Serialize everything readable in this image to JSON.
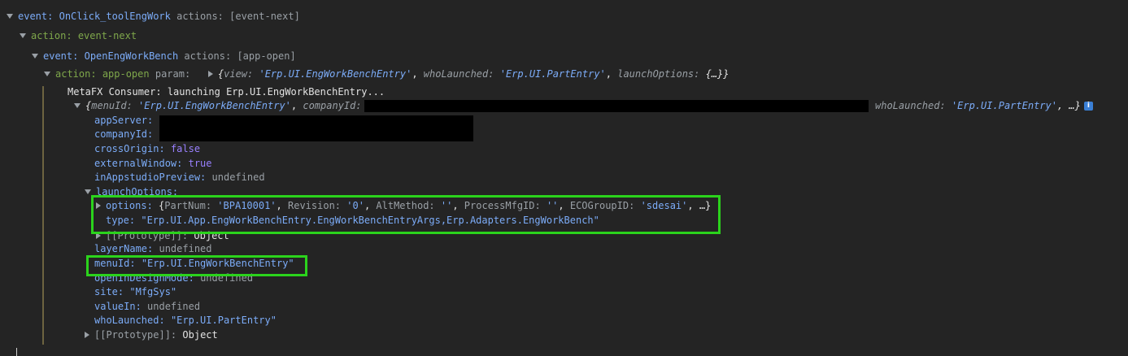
{
  "lines": {
    "l1": {
      "event_label": "event:",
      "event_name": "OnClick_toolEngWork",
      "actions": "actions: [event-next]"
    },
    "l2": {
      "action_label": "action:",
      "action_name": "event-next"
    },
    "l3": {
      "event_label": "event:",
      "event_name": "OpenEngWorkBench",
      "actions": "actions: [app-open]"
    },
    "l4": {
      "action_label": "action:",
      "action_name": "app-open",
      "param_label": "param:",
      "open_brace": "{",
      "k_view": "view:",
      "v_view": "'Erp.UI.EngWorkBenchEntry'",
      "k_who": "whoLaunched:",
      "v_who": "'Erp.UI.PartEntry'",
      "k_launch": "launchOptions:",
      "v_launch": "{…}",
      "close_brace": "}"
    },
    "l5": {
      "text": "MetaFX Consumer: launching Erp.UI.EngWorkBenchEntry..."
    },
    "l6": {
      "open_brace": "{",
      "k_menu": "menuId:",
      "v_menu": "'Erp.UI.EngWorkBenchEntry'",
      "k_company": "companyId:",
      "k_who": "whoLaunched:",
      "v_who": "'Erp.UI.PartEntry'",
      "tail": ", …}",
      "info": "i"
    },
    "props": {
      "appServer": "appServer:",
      "companyId": "companyId:",
      "crossOrigin_k": "crossOrigin:",
      "crossOrigin_v": "false",
      "externalWindow_k": "externalWindow:",
      "externalWindow_v": "true",
      "inAppstudioPreview_k": "inAppstudioPreview:",
      "inAppstudioPreview_v": "undefined",
      "launchOptions_k": "launchOptions:",
      "options_k": "options:",
      "options_v": {
        "open": "{",
        "k1": "PartNum:",
        "v1": "'BPA10001'",
        "k2": "Revision:",
        "v2": "'0'",
        "k3": "AltMethod:",
        "v3": "''",
        "k4": "ProcessMfgID:",
        "v4": "''",
        "k5": "ECOGroupID:",
        "v5": "'sdesai'",
        "tail": ", …}"
      },
      "type_k": "type:",
      "type_v": "\"Erp.UI.App.EngWorkBenchEntry.EngWorkBenchEntryArgs,Erp.Adapters.EngWorkBench\"",
      "proto1_k": "[[Prototype]]:",
      "proto1_v": "Object",
      "layerName_k": "layerName:",
      "layerName_v": "undefined",
      "menuId_k": "menuId:",
      "menuId_v": "\"Erp.UI.EngWorkBenchEntry\"",
      "openInDesignMode_k": "openInDesignMode:",
      "openInDesignMode_v": "undefined",
      "site_k": "site:",
      "site_v": "\"MfgSys\"",
      "valueIn_k": "valueIn:",
      "valueIn_v": "undefined",
      "whoLaunched_k": "whoLaunched:",
      "whoLaunched_v": "\"Erp.UI.PartEntry\"",
      "proto2_k": "[[Prototype]]:",
      "proto2_v": "Object"
    }
  },
  "colors": {
    "background": "#242424",
    "key": "#7cacf8",
    "action_green": "#7fa84b",
    "bool_purple": "#9980ff",
    "dim": "#9aa0a6",
    "highlight_box": "#2bd31c",
    "redaction": "#000000"
  },
  "icons": {
    "expand": "triangle-down",
    "collapse": "triangle-right",
    "info": "info-badge"
  }
}
